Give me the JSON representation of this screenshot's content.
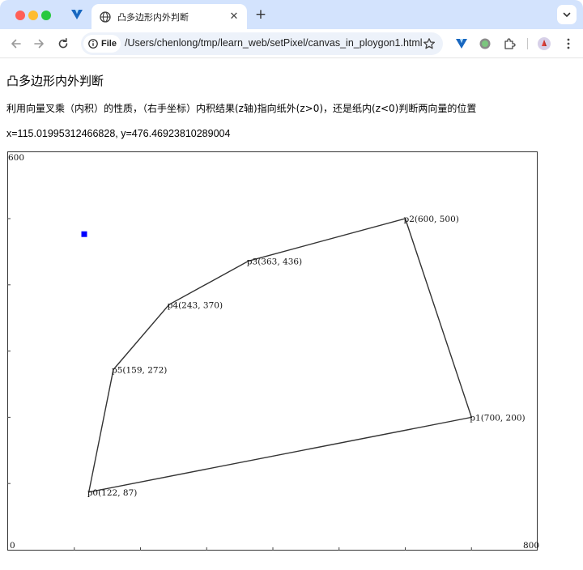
{
  "browser": {
    "tab": {
      "title": "凸多边形内外判断"
    },
    "omnibox": {
      "scheme_chip": "File",
      "url": "/Users/chenlong/tmp/learn_web/setPixel/canvas_in_ploygon1.html"
    },
    "new_tab_symbol": "+",
    "close_symbol": "✕"
  },
  "page": {
    "title": "凸多边形内外判断",
    "description": "利用向量叉乘（内积）的性质，（右手坐标）内积结果(z轴)指向纸外(z>0)，还是纸内(z<0)判断两向量的位置",
    "cursor_readout": "x=115.01995312466828, y=476.46923810289004"
  },
  "chart_data": {
    "type": "scatter",
    "x_range": [
      0,
      800
    ],
    "y_range": [
      0,
      600
    ],
    "x_tick_labels": {
      "min": "0",
      "max": "800"
    },
    "y_tick_labels": {
      "max": "600"
    },
    "x_ticks": [
      0,
      100,
      200,
      300,
      400,
      500,
      600,
      700,
      800
    ],
    "y_ticks": [
      0,
      100,
      200,
      300,
      400,
      500,
      600
    ],
    "polygon": [
      {
        "name": "p0",
        "x": 122,
        "y": 87,
        "label": "p0(122, 87)"
      },
      {
        "name": "p1",
        "x": 700,
        "y": 200,
        "label": "p1(700, 200)"
      },
      {
        "name": "p2",
        "x": 600,
        "y": 500,
        "label": "p2(600, 500)"
      },
      {
        "name": "p3",
        "x": 363,
        "y": 436,
        "label": "p3(363, 436)"
      },
      {
        "name": "p4",
        "x": 243,
        "y": 370,
        "label": "p4(243, 370)"
      },
      {
        "name": "p5",
        "x": 159,
        "y": 272,
        "label": "p5(159, 272)"
      }
    ],
    "test_point": {
      "x": 115.02,
      "y": 476.47,
      "color": "#0000ff"
    },
    "line_color": "#333333"
  }
}
